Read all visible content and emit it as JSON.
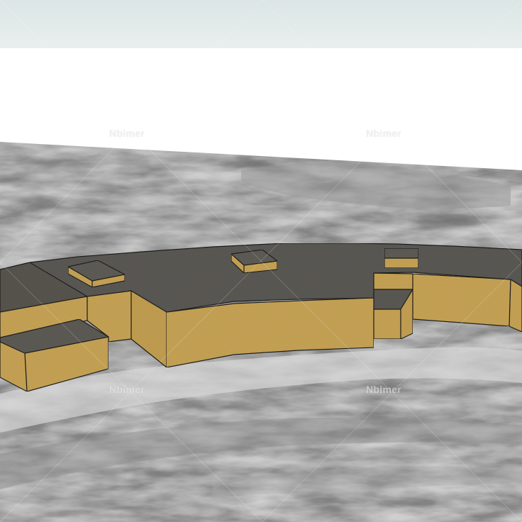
{
  "scene": {
    "sky_color": "#e2ebea",
    "background_color": "#ffffff",
    "terrain_colors": [
      "#2d2d2d",
      "#4a4a4a",
      "#8a8a8a",
      "#b5b5b5"
    ],
    "roof_color": "#5c5a55",
    "wall_color": "#c9a556",
    "wall_shade_color": "#a98a44",
    "edge_color": "#1c1c1c"
  },
  "watermark": {
    "text": "Nbimer",
    "count": 4
  }
}
